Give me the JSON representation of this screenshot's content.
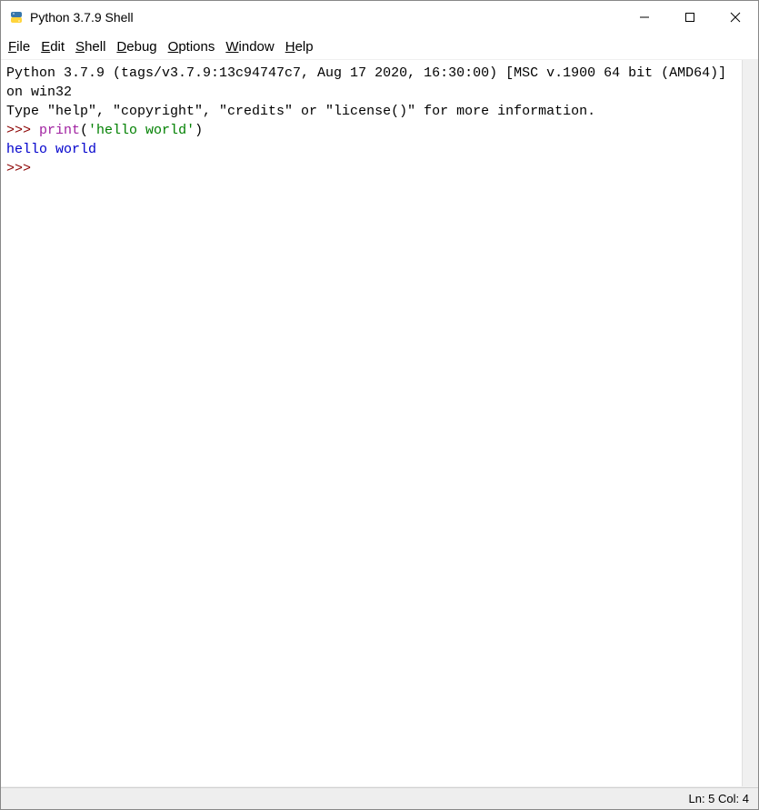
{
  "window": {
    "title": "Python 3.7.9 Shell"
  },
  "menubar": {
    "file": "File",
    "edit": "Edit",
    "shell": "Shell",
    "debug": "Debug",
    "options": "Options",
    "window": "Window",
    "help": "Help"
  },
  "shell": {
    "banner_line1": "Python 3.7.9 (tags/v3.7.9:13c94747c7, Aug 17 2020, 16:30:00) [MSC v.1900 64 bit (AMD64)] on win32",
    "banner_line2": "Type \"help\", \"copyright\", \"credits\" or \"license()\" for more information.",
    "prompt": ">>> ",
    "stmt1_func": "print",
    "stmt1_open": "(",
    "stmt1_str": "'hello world'",
    "stmt1_close": ")",
    "output1": "hello world",
    "prompt2": ">>> "
  },
  "statusbar": {
    "text": "Ln: 5  Col: 4"
  }
}
